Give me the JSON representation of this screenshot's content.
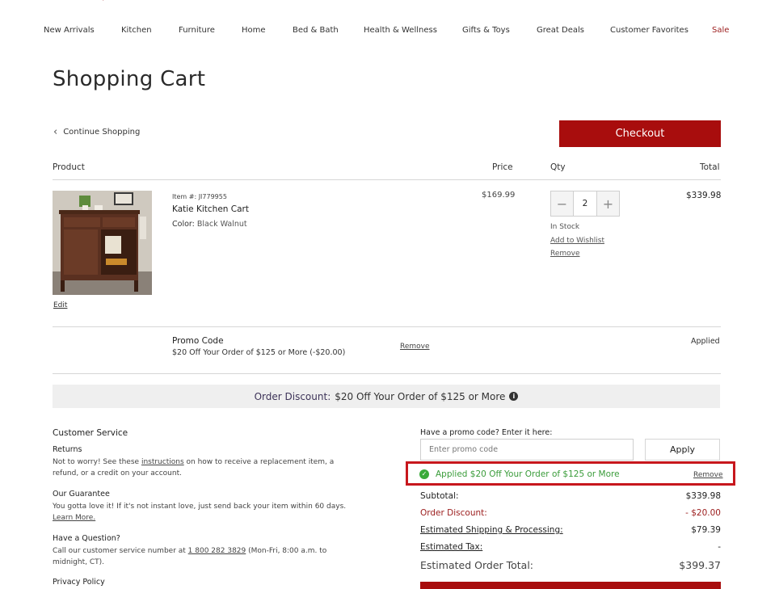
{
  "nav": {
    "items": [
      "New Arrivals",
      "Kitchen",
      "Furniture",
      "Home",
      "Bed & Bath",
      "Health & Wellness",
      "Gifts & Toys",
      "Great Deals",
      "Customer Favorites",
      "Sale"
    ]
  },
  "page": {
    "title": "Shopping Cart",
    "continue_label": "Continue Shopping",
    "checkout_label": "Checkout"
  },
  "table": {
    "headers": {
      "product": "Product",
      "price": "Price",
      "qty": "Qty",
      "total": "Total"
    }
  },
  "item": {
    "item_no": "Item #: JI779955",
    "name": "Katie Kitchen Cart",
    "color_label": "Color:",
    "color_value": "Black Walnut",
    "edit_label": "Edit",
    "price": "$169.99",
    "quantity": "2",
    "stock": "In Stock",
    "wishlist_label": "Add to Wishlist",
    "remove_label": "Remove",
    "total": "$339.98"
  },
  "promo_line": {
    "title": "Promo Code",
    "desc": "$20 Off Your Order of $125 or More (-$20.00)",
    "remove_label": "Remove",
    "status": "Applied"
  },
  "discount_bar": {
    "label": "Order Discount:",
    "text": "$20 Off Your Order of $125 or More"
  },
  "customer_service": {
    "title": "Customer Service",
    "returns_title": "Returns",
    "returns_text_1": "Not to worry! See these ",
    "returns_link": "instructions",
    "returns_text_2": " on how to receive a replacement item, a refund, or a credit on your account.",
    "guarantee_title": "Our Guarantee",
    "guarantee_text": "You gotta love it! If it's not instant love, just send back your item within 60 days.",
    "guarantee_link": "Learn More.",
    "question_title": "Have a Question?",
    "question_text_1": "Call our customer service number at ",
    "question_phone": "1 800 282 3829",
    "question_text_2": " (Mon-Fri, 8:00 a.m. to midnight, CT).",
    "privacy_title": "Privacy Policy"
  },
  "promo_entry": {
    "label": "Have a promo code? Enter it here:",
    "placeholder": "Enter promo code",
    "apply_label": "Apply",
    "applied_text": "Applied $20 Off Your Order of $125 or More",
    "applied_remove": "Remove"
  },
  "summary": {
    "subtotal_label": "Subtotal:",
    "subtotal": "$339.98",
    "discount_label": "Order Discount:",
    "discount": "- $20.00",
    "shipping_label": "Estimated Shipping & Processing:",
    "shipping": "$79.39",
    "tax_label": "Estimated Tax:",
    "tax": "-",
    "total_label": "Estimated Order Total:",
    "total": "$399.37"
  },
  "colors": {
    "brand_red": "#a80d0d",
    "highlight_red": "#c7171d",
    "success_green": "#3aaa3a"
  }
}
